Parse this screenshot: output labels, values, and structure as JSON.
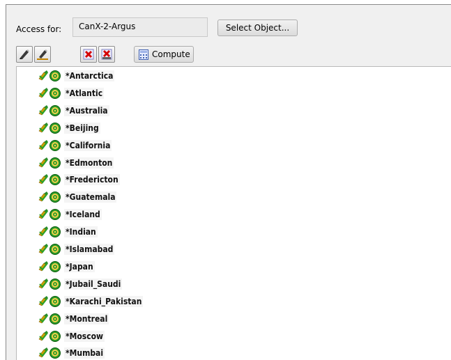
{
  "access": {
    "label": "Access for:",
    "value": "CanX-2-Argus",
    "select_button": "Select Object..."
  },
  "toolbar": {
    "buttons": [
      {
        "icon": "pen-icon"
      },
      {
        "icon": "pen-edit-icon"
      },
      {
        "icon": "delete-icon"
      },
      {
        "icon": "delete-all-icon"
      }
    ],
    "compute_label": "Compute"
  },
  "tree": {
    "items": [
      {
        "label": "*Antarctica"
      },
      {
        "label": "*Atlantic"
      },
      {
        "label": "*Australia"
      },
      {
        "label": "*Beijing"
      },
      {
        "label": "*California"
      },
      {
        "label": "*Edmonton"
      },
      {
        "label": "*Fredericton"
      },
      {
        "label": "*Guatemala"
      },
      {
        "label": "*Iceland"
      },
      {
        "label": "*Indian"
      },
      {
        "label": "*Islamabad"
      },
      {
        "label": "*Japan"
      },
      {
        "label": "*Jubail_Saudi"
      },
      {
        "label": "*Karachi_Pakistan"
      },
      {
        "label": "*Montreal"
      },
      {
        "label": "*Moscow"
      },
      {
        "label": "*Mumbai"
      }
    ]
  }
}
